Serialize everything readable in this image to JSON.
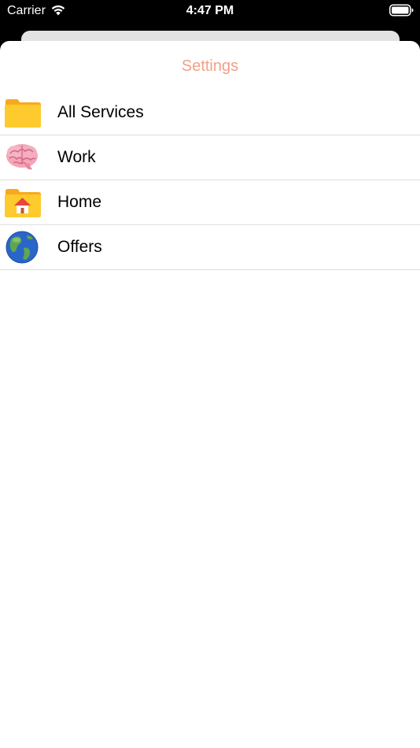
{
  "status_bar": {
    "carrier": "Carrier",
    "time": "4:47 PM",
    "wifi_icon": "wifi-icon",
    "battery_icon": "battery-full-icon"
  },
  "header": {
    "title": "Settings",
    "title_color": "#f0a08a"
  },
  "list": {
    "items": [
      {
        "label": "All Services",
        "icon": "folder-icon"
      },
      {
        "label": "Work",
        "icon": "brain-icon"
      },
      {
        "label": "Home",
        "icon": "house-folder-icon"
      },
      {
        "label": "Offers",
        "icon": "globe-icon"
      }
    ]
  }
}
